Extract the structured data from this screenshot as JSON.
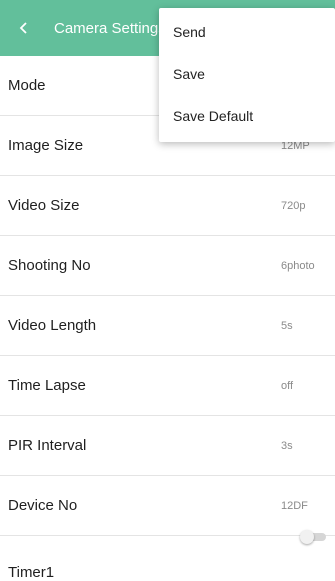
{
  "header": {
    "title": "Camera Settings",
    "bg_color": "#62bf9b",
    "back_icon": "chevron-left-icon"
  },
  "settings": {
    "rows": [
      {
        "label": "Mode",
        "value": ""
      },
      {
        "label": "Image Size",
        "value": "12MP"
      },
      {
        "label": "Video Size",
        "value": "720p"
      },
      {
        "label": "Shooting No",
        "value": "6photo"
      },
      {
        "label": "Video Length",
        "value": "5s"
      },
      {
        "label": "Time Lapse",
        "value": "off"
      },
      {
        "label": "PIR Interval",
        "value": "3s"
      },
      {
        "label": "Device No",
        "value": "12DF"
      },
      {
        "label": "Timer1",
        "toggle": "off"
      }
    ]
  },
  "menu": {
    "items": [
      "Send",
      "Save",
      "Save Default"
    ]
  }
}
